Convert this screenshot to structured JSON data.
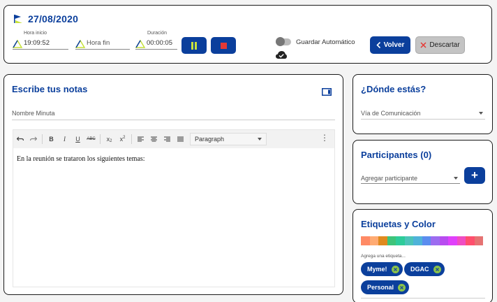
{
  "header": {
    "date": "27/08/2020",
    "start": {
      "label": "Hora inicio",
      "value": "19:09:52"
    },
    "end": {
      "label": "",
      "value": "Hora fin"
    },
    "duration": {
      "label": "Duración",
      "value": "00:00:05"
    },
    "autosave_label": "Guardar Automático",
    "back_label": "Volver",
    "discard_label": "Descartar",
    "colors": {
      "accent": "#0b3f9c",
      "pause_icon": "#c7e23a",
      "stop_icon": "#e53935"
    }
  },
  "notes": {
    "title": "Escribe tus notas",
    "name_placeholder": "Nombre Minuta",
    "format_value": "Paragraph",
    "toolbar_icons": [
      "undo-icon",
      "redo-icon",
      "bold-icon",
      "italic-icon",
      "underline-icon",
      "strikethrough-icon",
      "subscript-icon",
      "superscript-icon",
      "align-left-icon",
      "align-center-icon",
      "align-right-icon",
      "align-justify-icon",
      "more-vert-icon"
    ],
    "body_text": "En la reunión se trataron los siguientes temas:"
  },
  "location": {
    "title": "¿Dónde estás?",
    "select_label": "Vía de Comunicación"
  },
  "participants": {
    "title": "Participantes (0)",
    "input_placeholder": "Agregar participante",
    "add_label": "+"
  },
  "tags": {
    "title": "Etiquetas y Color",
    "palette": [
      "#ff8a65",
      "#ffab73",
      "#e08a1e",
      "#3ec47a",
      "#2ecc9a",
      "#4cc4b8",
      "#4fb3d9",
      "#5b8def",
      "#9c6cf0",
      "#b84cf0",
      "#e040fb",
      "#f04dc2",
      "#ff4f6d",
      "#e57373"
    ],
    "input_label": "Agrega una etiqueta...",
    "chips": [
      "Myme!",
      "DGAC",
      "Personal"
    ]
  }
}
